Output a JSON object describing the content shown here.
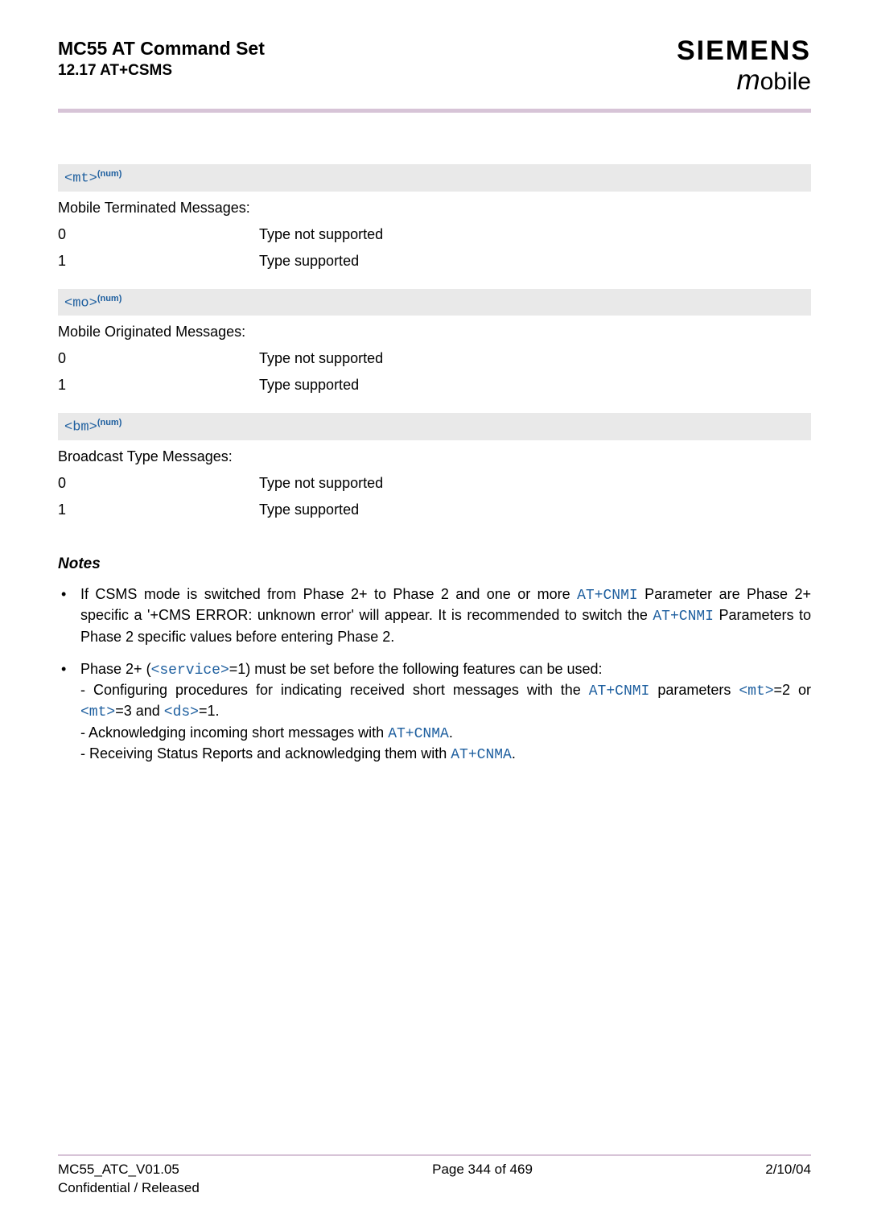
{
  "header": {
    "doc_title": "MC55 AT Command Set",
    "doc_subtitle": "12.17 AT+CSMS",
    "brand_top": "SIEMENS",
    "brand_m": "m",
    "brand_rest": "obile"
  },
  "params": [
    {
      "code": "<mt>",
      "sup": "(num)",
      "desc": "Mobile Terminated Messages:",
      "rows": [
        {
          "k": "0",
          "v": "Type not supported"
        },
        {
          "k": "1",
          "v": "Type supported"
        }
      ]
    },
    {
      "code": "<mo>",
      "sup": "(num)",
      "desc": "Mobile Originated Messages:",
      "rows": [
        {
          "k": "0",
          "v": "Type not supported"
        },
        {
          "k": "1",
          "v": "Type supported"
        }
      ]
    },
    {
      "code": "<bm>",
      "sup": "(num)",
      "desc": "Broadcast Type Messages:",
      "rows": [
        {
          "k": "0",
          "v": "Type not supported"
        },
        {
          "k": "1",
          "v": "Type supported"
        }
      ]
    }
  ],
  "notes_title": "Notes",
  "notes": {
    "n1_a": "If CSMS mode is switched from Phase 2+ to Phase 2 and one or more ",
    "n1_cnmi1": "AT+CNMI",
    "n1_b": " Parameter are Phase 2+ specific a '+CMS ERROR: unknown error' will appear. It is recommended to switch the ",
    "n1_cnmi2": "AT+CNMI",
    "n1_c": " Parameters to Phase 2 specific values before entering Phase 2.",
    "n2_a": "Phase 2+ (",
    "n2_service": "<service>",
    "n2_b": "=1) must be set before the following features can be used:",
    "n2_s1a": "- Configuring procedures for indicating received short messages with the ",
    "n2_s1cnmi": "AT+CNMI",
    "n2_s1b": " parameters ",
    "n2_s1mt1": "<mt>",
    "n2_s1c": "=2 or ",
    "n2_s1mt2": "<mt>",
    "n2_s1d": "=3 and ",
    "n2_s1ds": "<ds>",
    "n2_s1e": "=1.",
    "n2_s2a": "- Acknowledging incoming short messages with ",
    "n2_s2cnma": "AT+CNMA",
    "n2_s2b": ".",
    "n2_s3a": "- Receiving Status Reports and acknowledging them with ",
    "n2_s3cnma": "AT+CNMA",
    "n2_s3b": "."
  },
  "footer": {
    "left1": "MC55_ATC_V01.05",
    "left2": "Confidential / Released",
    "center": "Page 344 of 469",
    "right": "2/10/04"
  }
}
